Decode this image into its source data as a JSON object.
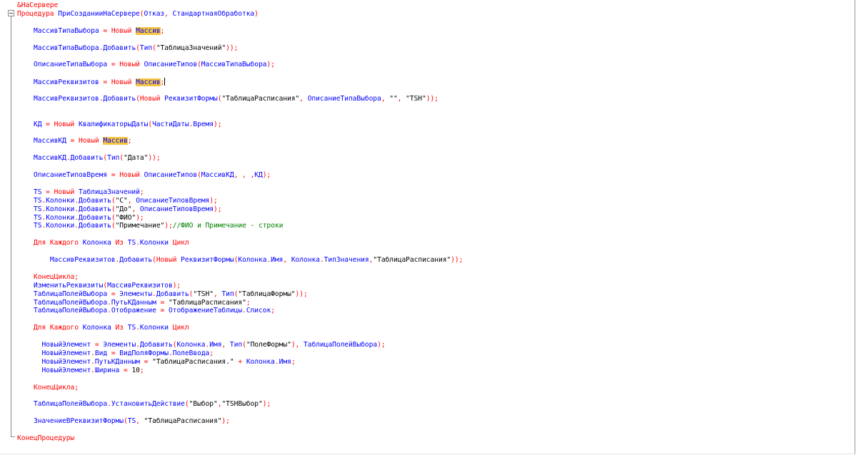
{
  "editor": {
    "lines": [
      [
        {
          "t": "&НаСервере",
          "c": "kw"
        }
      ],
      [
        {
          "t": "Процедура ",
          "c": "kw"
        },
        {
          "t": "ПриСозданииНаСервере",
          "c": "id"
        },
        {
          "t": "(",
          "c": "kw"
        },
        {
          "t": "Отказ",
          "c": "id"
        },
        {
          "t": ", ",
          "c": "kw"
        },
        {
          "t": "СтандартнаяОбработка",
          "c": "id"
        },
        {
          "t": ")",
          "c": "kw"
        }
      ],
      [],
      [
        {
          "t": "МассивТипаВыбора",
          "c": "id"
        },
        {
          "t": " = ",
          "c": "kw"
        },
        {
          "t": "Новый ",
          "c": "kw"
        },
        {
          "t": "Массив",
          "c": "id",
          "hl": true
        },
        {
          "t": ";",
          "c": "kw"
        }
      ],
      [],
      [
        {
          "t": "МассивТипаВыбора",
          "c": "id"
        },
        {
          "t": ".",
          "c": "kw"
        },
        {
          "t": "Добавить",
          "c": "id"
        },
        {
          "t": "(",
          "c": "kw"
        },
        {
          "t": "Тип",
          "c": "id"
        },
        {
          "t": "(",
          "c": "kw"
        },
        {
          "t": "\"ТаблицаЗначений\"",
          "c": "st"
        },
        {
          "t": "));",
          "c": "kw"
        }
      ],
      [],
      [
        {
          "t": "ОписаниеТипаВыбора",
          "c": "id"
        },
        {
          "t": " = ",
          "c": "kw"
        },
        {
          "t": "Новый ",
          "c": "kw"
        },
        {
          "t": "ОписаниеТипов",
          "c": "id"
        },
        {
          "t": "(",
          "c": "kw"
        },
        {
          "t": "МассивТипаВыбора",
          "c": "id"
        },
        {
          "t": ");",
          "c": "kw"
        }
      ],
      [],
      [
        {
          "t": "МассивРеквизитов",
          "c": "id"
        },
        {
          "t": " = ",
          "c": "kw"
        },
        {
          "t": "Новый ",
          "c": "kw"
        },
        {
          "t": "Массив",
          "c": "id",
          "hl": true
        },
        {
          "t": ";",
          "c": "kw",
          "caret": true
        }
      ],
      [],
      [
        {
          "t": "МассивРеквизитов",
          "c": "id"
        },
        {
          "t": ".",
          "c": "kw"
        },
        {
          "t": "Добавить",
          "c": "id"
        },
        {
          "t": "(",
          "c": "kw"
        },
        {
          "t": "Новый ",
          "c": "kw"
        },
        {
          "t": "РеквизитФормы",
          "c": "id"
        },
        {
          "t": "(",
          "c": "kw"
        },
        {
          "t": "\"ТаблицаРасписания\"",
          "c": "st"
        },
        {
          "t": ", ",
          "c": "kw"
        },
        {
          "t": "ОписаниеТипаВыбора",
          "c": "id"
        },
        {
          "t": ", ",
          "c": "kw"
        },
        {
          "t": "\"\"",
          "c": "st"
        },
        {
          "t": ", ",
          "c": "kw"
        },
        {
          "t": "\"TSH\"",
          "c": "st"
        },
        {
          "t": "));",
          "c": "kw"
        }
      ],
      [],
      [],
      [
        {
          "t": "КД",
          "c": "id"
        },
        {
          "t": " = ",
          "c": "kw"
        },
        {
          "t": "Новый ",
          "c": "kw"
        },
        {
          "t": "КвалификаторыДаты",
          "c": "id"
        },
        {
          "t": "(",
          "c": "kw"
        },
        {
          "t": "ЧастиДаты",
          "c": "id"
        },
        {
          "t": ".",
          "c": "kw"
        },
        {
          "t": "Время",
          "c": "id"
        },
        {
          "t": ");",
          "c": "kw"
        }
      ],
      [],
      [
        {
          "t": "МассивКД",
          "c": "id"
        },
        {
          "t": " = ",
          "c": "kw"
        },
        {
          "t": "Новый ",
          "c": "kw"
        },
        {
          "t": "Массив",
          "c": "id",
          "hl": true
        },
        {
          "t": ";",
          "c": "kw"
        }
      ],
      [],
      [
        {
          "t": "МассивКД",
          "c": "id"
        },
        {
          "t": ".",
          "c": "kw"
        },
        {
          "t": "Добавить",
          "c": "id"
        },
        {
          "t": "(",
          "c": "kw"
        },
        {
          "t": "Тип",
          "c": "id"
        },
        {
          "t": "(",
          "c": "kw"
        },
        {
          "t": "\"Дата\"",
          "c": "st"
        },
        {
          "t": "));",
          "c": "kw"
        }
      ],
      [],
      [
        {
          "t": "ОписаниеТиповВремя",
          "c": "id"
        },
        {
          "t": " = ",
          "c": "kw"
        },
        {
          "t": "Новый ",
          "c": "kw"
        },
        {
          "t": "ОписаниеТипов",
          "c": "id"
        },
        {
          "t": "(",
          "c": "kw"
        },
        {
          "t": "МассивКД",
          "c": "id"
        },
        {
          "t": ", , ,",
          "c": "kw"
        },
        {
          "t": "КД",
          "c": "id"
        },
        {
          "t": ");",
          "c": "kw"
        }
      ],
      [],
      [
        {
          "t": "TS",
          "c": "id"
        },
        {
          "t": " = ",
          "c": "kw"
        },
        {
          "t": "Новый ",
          "c": "kw"
        },
        {
          "t": "ТаблицаЗначений",
          "c": "id"
        },
        {
          "t": ";",
          "c": "kw"
        }
      ],
      [
        {
          "t": "TS",
          "c": "id"
        },
        {
          "t": ".",
          "c": "kw"
        },
        {
          "t": "Колонки",
          "c": "id"
        },
        {
          "t": ".",
          "c": "kw"
        },
        {
          "t": "Добавить",
          "c": "id"
        },
        {
          "t": "(",
          "c": "kw"
        },
        {
          "t": "\"С\"",
          "c": "st"
        },
        {
          "t": ", ",
          "c": "kw"
        },
        {
          "t": "ОписаниеТиповВремя",
          "c": "id"
        },
        {
          "t": ");",
          "c": "kw"
        }
      ],
      [
        {
          "t": "TS",
          "c": "id"
        },
        {
          "t": ".",
          "c": "kw"
        },
        {
          "t": "Колонки",
          "c": "id"
        },
        {
          "t": ".",
          "c": "kw"
        },
        {
          "t": "Добавить",
          "c": "id"
        },
        {
          "t": "(",
          "c": "kw"
        },
        {
          "t": "\"До\"",
          "c": "st"
        },
        {
          "t": ", ",
          "c": "kw"
        },
        {
          "t": "ОписаниеТиповВремя",
          "c": "id"
        },
        {
          "t": ");",
          "c": "kw"
        }
      ],
      [
        {
          "t": "TS",
          "c": "id"
        },
        {
          "t": ".",
          "c": "kw"
        },
        {
          "t": "Колонки",
          "c": "id"
        },
        {
          "t": ".",
          "c": "kw"
        },
        {
          "t": "Добавить",
          "c": "id"
        },
        {
          "t": "(",
          "c": "kw"
        },
        {
          "t": "\"ФИО\"",
          "c": "st"
        },
        {
          "t": ");",
          "c": "kw"
        }
      ],
      [
        {
          "t": "TS",
          "c": "id"
        },
        {
          "t": ".",
          "c": "kw"
        },
        {
          "t": "Колонки",
          "c": "id"
        },
        {
          "t": ".",
          "c": "kw"
        },
        {
          "t": "Добавить",
          "c": "id"
        },
        {
          "t": "(",
          "c": "kw"
        },
        {
          "t": "\"Примечание\"",
          "c": "st"
        },
        {
          "t": ");",
          "c": "kw"
        },
        {
          "t": "//ФИО и Примечание - строки",
          "c": "cm"
        }
      ],
      [],
      [
        {
          "t": "Для Каждого ",
          "c": "kw"
        },
        {
          "t": "Колонка",
          "c": "id"
        },
        {
          "t": " Из ",
          "c": "kw"
        },
        {
          "t": "TS",
          "c": "id"
        },
        {
          "t": ".",
          "c": "kw"
        },
        {
          "t": "Колонки",
          "c": "id"
        },
        {
          "t": " Цикл",
          "c": "kw"
        }
      ],
      [],
      [
        {
          "t": "    ",
          "c": "kw"
        },
        {
          "t": "МассивРеквизитов",
          "c": "id"
        },
        {
          "t": ".",
          "c": "kw"
        },
        {
          "t": "Добавить",
          "c": "id"
        },
        {
          "t": "(",
          "c": "kw"
        },
        {
          "t": "Новый ",
          "c": "kw"
        },
        {
          "t": "РеквизитФормы",
          "c": "id"
        },
        {
          "t": "(",
          "c": "kw"
        },
        {
          "t": "Колонка",
          "c": "id"
        },
        {
          "t": ".",
          "c": "kw"
        },
        {
          "t": "Имя",
          "c": "id"
        },
        {
          "t": ", ",
          "c": "kw"
        },
        {
          "t": "Колонка",
          "c": "id"
        },
        {
          "t": ".",
          "c": "kw"
        },
        {
          "t": "ТипЗначения",
          "c": "id"
        },
        {
          "t": ",",
          "c": "kw"
        },
        {
          "t": "\"ТаблицаРасписания\"",
          "c": "st"
        },
        {
          "t": "));",
          "c": "kw"
        }
      ],
      [],
      [
        {
          "t": "КонецЦикла;",
          "c": "kw"
        }
      ],
      [
        {
          "t": "ИзменитьРеквизиты",
          "c": "id"
        },
        {
          "t": "(",
          "c": "kw"
        },
        {
          "t": "МассивРеквизитов",
          "c": "id"
        },
        {
          "t": ");",
          "c": "kw"
        }
      ],
      [
        {
          "t": "ТаблицаПолейВыбора",
          "c": "id"
        },
        {
          "t": " = ",
          "c": "kw"
        },
        {
          "t": "Элементы",
          "c": "id"
        },
        {
          "t": ".",
          "c": "kw"
        },
        {
          "t": "Добавить",
          "c": "id"
        },
        {
          "t": "(",
          "c": "kw"
        },
        {
          "t": "\"TSH\"",
          "c": "st"
        },
        {
          "t": ", ",
          "c": "kw"
        },
        {
          "t": "Тип",
          "c": "id"
        },
        {
          "t": "(",
          "c": "kw"
        },
        {
          "t": "\"ТаблицаФормы\"",
          "c": "st"
        },
        {
          "t": "));",
          "c": "kw"
        }
      ],
      [
        {
          "t": "ТаблицаПолейВыбора",
          "c": "id"
        },
        {
          "t": ".",
          "c": "kw"
        },
        {
          "t": "ПутьКДанным",
          "c": "id"
        },
        {
          "t": " = ",
          "c": "kw"
        },
        {
          "t": "\"ТаблицаРасписания\"",
          "c": "st"
        },
        {
          "t": ";",
          "c": "kw"
        }
      ],
      [
        {
          "t": "ТаблицаПолейВыбора",
          "c": "id"
        },
        {
          "t": ".",
          "c": "kw"
        },
        {
          "t": "Отображение",
          "c": "id"
        },
        {
          "t": " = ",
          "c": "kw"
        },
        {
          "t": "ОтображениеТаблицы",
          "c": "id"
        },
        {
          "t": ".",
          "c": "kw"
        },
        {
          "t": "Список",
          "c": "id"
        },
        {
          "t": ";",
          "c": "kw"
        }
      ],
      [],
      [
        {
          "t": "Для Каждого ",
          "c": "kw"
        },
        {
          "t": "Колонка",
          "c": "id"
        },
        {
          "t": " Из ",
          "c": "kw"
        },
        {
          "t": "TS",
          "c": "id"
        },
        {
          "t": ".",
          "c": "kw"
        },
        {
          "t": "Колонки",
          "c": "id"
        },
        {
          "t": " Цикл",
          "c": "kw"
        }
      ],
      [],
      [
        {
          "t": "  ",
          "c": "kw"
        },
        {
          "t": "НовыйЭлемент",
          "c": "id"
        },
        {
          "t": " = ",
          "c": "kw"
        },
        {
          "t": "Элементы",
          "c": "id"
        },
        {
          "t": ".",
          "c": "kw"
        },
        {
          "t": "Добавить",
          "c": "id"
        },
        {
          "t": "(",
          "c": "kw"
        },
        {
          "t": "Колонка",
          "c": "id"
        },
        {
          "t": ".",
          "c": "kw"
        },
        {
          "t": "Имя",
          "c": "id"
        },
        {
          "t": ", ",
          "c": "kw"
        },
        {
          "t": "Тип",
          "c": "id"
        },
        {
          "t": "(",
          "c": "kw"
        },
        {
          "t": "\"ПолеФормы\"",
          "c": "st"
        },
        {
          "t": "), ",
          "c": "kw"
        },
        {
          "t": "ТаблицаПолейВыбора",
          "c": "id"
        },
        {
          "t": ");",
          "c": "kw"
        }
      ],
      [
        {
          "t": "  ",
          "c": "kw"
        },
        {
          "t": "НовыйЭлемент",
          "c": "id"
        },
        {
          "t": ".",
          "c": "kw"
        },
        {
          "t": "Вид",
          "c": "id"
        },
        {
          "t": " = ",
          "c": "kw"
        },
        {
          "t": "ВидПоляФормы",
          "c": "id"
        },
        {
          "t": ".",
          "c": "kw"
        },
        {
          "t": "ПолеВвода",
          "c": "id"
        },
        {
          "t": ";",
          "c": "kw"
        }
      ],
      [
        {
          "t": "  ",
          "c": "kw"
        },
        {
          "t": "НовыйЭлемент",
          "c": "id"
        },
        {
          "t": ".",
          "c": "kw"
        },
        {
          "t": "ПутьКДанным",
          "c": "id"
        },
        {
          "t": " = ",
          "c": "kw"
        },
        {
          "t": "\"ТаблицаРасписания.\"",
          "c": "st"
        },
        {
          "t": " + ",
          "c": "kw"
        },
        {
          "t": "Колонка",
          "c": "id"
        },
        {
          "t": ".",
          "c": "kw"
        },
        {
          "t": "Имя",
          "c": "id"
        },
        {
          "t": ";",
          "c": "kw"
        }
      ],
      [
        {
          "t": "  ",
          "c": "kw"
        },
        {
          "t": "НовыйЭлемент",
          "c": "id"
        },
        {
          "t": ".",
          "c": "kw"
        },
        {
          "t": "Ширина",
          "c": "id"
        },
        {
          "t": " = ",
          "c": "kw"
        },
        {
          "t": "10",
          "c": "st"
        },
        {
          "t": ";",
          "c": "kw"
        }
      ],
      [],
      [
        {
          "t": "КонецЦикла;",
          "c": "kw"
        }
      ],
      [],
      [
        {
          "t": "ТаблицаПолейВыбора",
          "c": "id"
        },
        {
          "t": ".",
          "c": "kw"
        },
        {
          "t": "УстановитьДействие",
          "c": "id"
        },
        {
          "t": "(",
          "c": "kw"
        },
        {
          "t": "\"Выбор\"",
          "c": "st"
        },
        {
          "t": ",",
          "c": "kw"
        },
        {
          "t": "\"TSHВыбор\"",
          "c": "st"
        },
        {
          "t": ");",
          "c": "kw"
        }
      ],
      [],
      [
        {
          "t": "ЗначениеВРеквизитФормы",
          "c": "id"
        },
        {
          "t": "(",
          "c": "kw"
        },
        {
          "t": "TS",
          "c": "id"
        },
        {
          "t": ", ",
          "c": "kw"
        },
        {
          "t": "\"ТаблицаРасписания\"",
          "c": "st"
        },
        {
          "t": ");",
          "c": "kw"
        }
      ],
      [],
      [
        {
          "t": "КонецПроцедуры",
          "c": "kw"
        }
      ]
    ]
  }
}
